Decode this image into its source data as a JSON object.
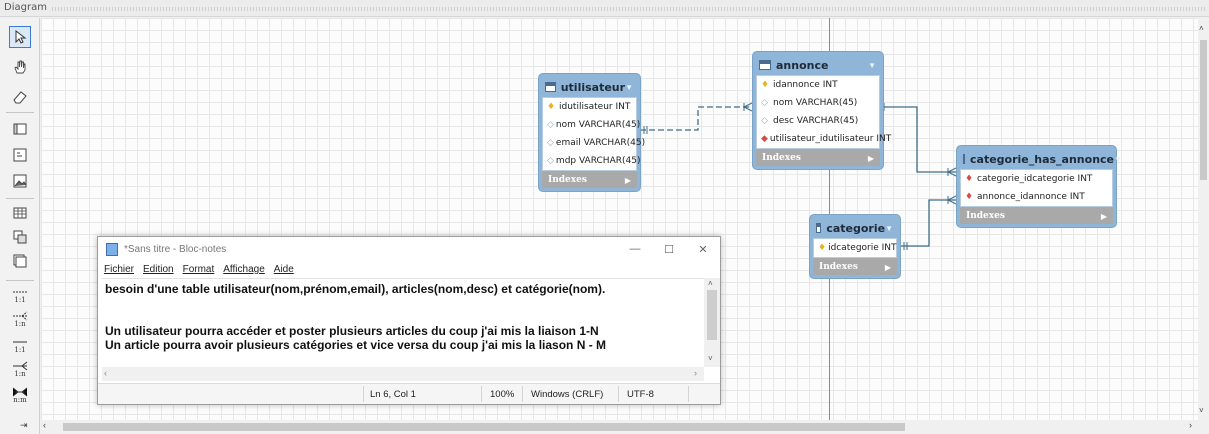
{
  "header": {
    "title": "Diagram"
  },
  "toolbar": {
    "relations": [
      "1:1",
      "1:n",
      "1:1",
      "1:n",
      "n:m"
    ]
  },
  "tables": {
    "utilisateur": {
      "name": "utilisateur",
      "columns": [
        "idutilisateur INT",
        "nom VARCHAR(45)",
        "email VARCHAR(45)",
        "mdp VARCHAR(45)"
      ],
      "indexes": "Indexes"
    },
    "annonce": {
      "name": "annonce",
      "columns": [
        "idannonce INT",
        "nom VARCHAR(45)",
        "desc VARCHAR(45)",
        "utilisateur_idutilisateur INT"
      ],
      "indexes": "Indexes"
    },
    "categorie_has_annonce": {
      "name": "categorie_has_annonce",
      "columns": [
        "categorie_idcategorie INT",
        "annonce_idannonce INT"
      ],
      "indexes": "Indexes"
    },
    "categorie": {
      "name": "categorie",
      "columns": [
        "idcategorie INT"
      ],
      "indexes": "Indexes"
    }
  },
  "notepad": {
    "title": "*Sans titre - Bloc-notes",
    "menu": [
      "Fichier",
      "Edition",
      "Format",
      "Affichage",
      "Aide"
    ],
    "lines": [
      "besoin d'une table utilisateur(nom,prénom,email), articles(nom,desc) et catégorie(nom).",
      "",
      "",
      "Un utilisateur pourra accéder et poster  plusieurs articles du coup j'ai mis la liaison 1-N",
      "Un article pourra avoir plusieurs catégories et vice versa du coup j'ai mis la liason N - M"
    ],
    "status": {
      "position": "Ln 6, Col 1",
      "zoom": "100%",
      "eol": "Windows (CRLF)",
      "encoding": "UTF-8"
    }
  },
  "colors": {
    "table_header": "#8fb6d8",
    "indexes_bar": "#a9a9a9",
    "relation_line": "#3f6e8a"
  }
}
